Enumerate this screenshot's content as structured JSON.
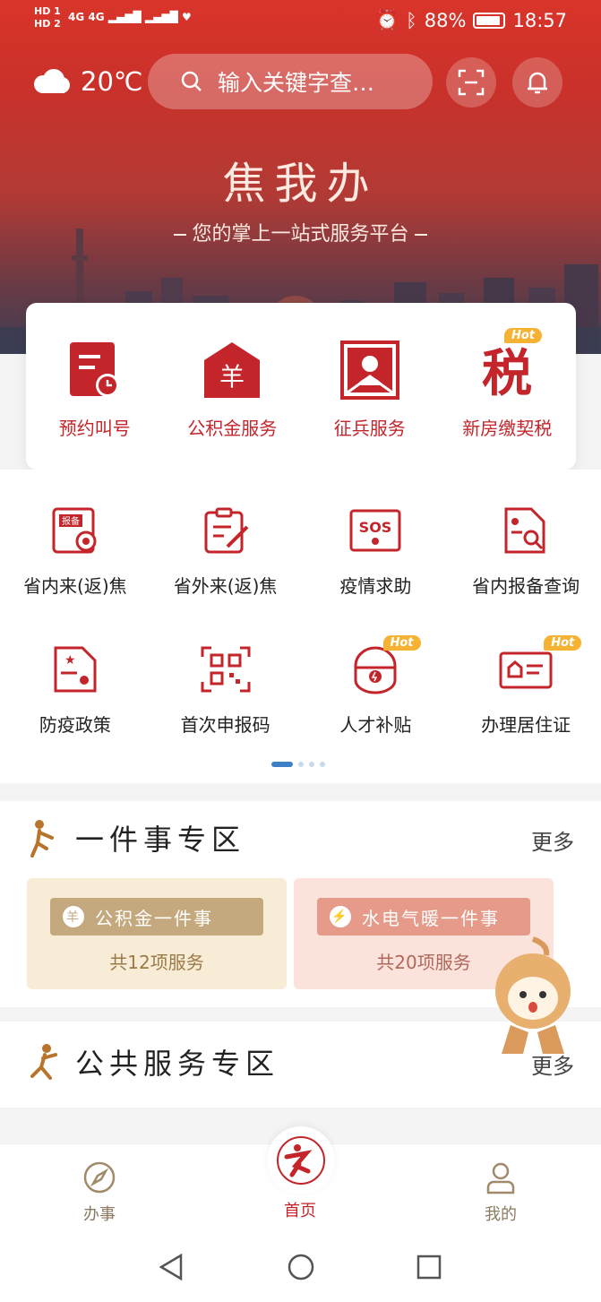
{
  "status_bar": {
    "sim1": "HD 1",
    "sim2": "HD 2",
    "network": "4G 4G",
    "battery": "88%",
    "time": "18:57"
  },
  "header": {
    "temperature": "20℃",
    "search_placeholder": "输入关键字查…",
    "title": "焦我办",
    "subtitle": "您的掌上一站式服务平台"
  },
  "main_services": [
    {
      "label": "预约叫号",
      "icon": "appointment-icon"
    },
    {
      "label": "公积金服务",
      "icon": "housing-fund-icon"
    },
    {
      "label": "征兵服务",
      "icon": "conscription-icon"
    },
    {
      "label": "新房缴契税",
      "icon": "tax-icon",
      "badge": "Hot"
    }
  ],
  "grid_services": [
    {
      "label": "省内来(返)焦",
      "icon": "report-icon"
    },
    {
      "label": "省外来(返)焦",
      "icon": "clipboard-edit-icon"
    },
    {
      "label": "疫情求助",
      "icon": "sos-icon"
    },
    {
      "label": "省内报备查询",
      "icon": "document-search-icon"
    },
    {
      "label": "防疫政策",
      "icon": "policy-doc-icon"
    },
    {
      "label": "首次申报码",
      "icon": "qr-code-icon"
    },
    {
      "label": "人才补贴",
      "icon": "talent-subsidy-icon",
      "badge": "Hot"
    },
    {
      "label": "办理居住证",
      "icon": "id-card-icon",
      "badge": "Hot"
    }
  ],
  "section_one": {
    "title": "一件事专区",
    "more": "更多",
    "panels": [
      {
        "tag": "公积金一件事",
        "count": "共12项服务",
        "tag_icon": "羊"
      },
      {
        "tag": "水电气暖一件事",
        "count": "共20项服务",
        "tag_icon": "⚡"
      }
    ]
  },
  "section_two": {
    "title": "公共服务专区",
    "more": "更多"
  },
  "bottom_nav": {
    "left": "办事",
    "center": "首页",
    "right": "我的"
  },
  "colors": {
    "brand_red": "#c4252b",
    "hot_badge": "#f6b233",
    "active_dot": "#3d80c5"
  }
}
